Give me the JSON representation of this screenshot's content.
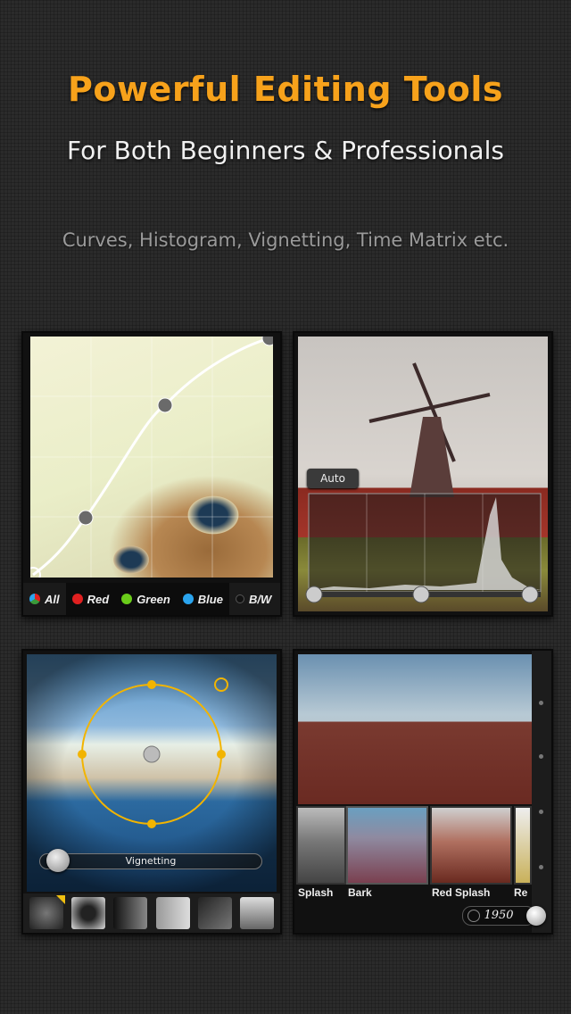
{
  "header": {
    "title": "Powerful Editing Tools",
    "subtitle": "For Both Beginners & Professionals",
    "caption": "Curves, Histogram, Vignetting, Time Matrix etc."
  },
  "curves": {
    "channels": [
      {
        "label": "All",
        "color": "#3a9a3a",
        "active": false
      },
      {
        "label": "Red",
        "color": "#e02020",
        "active": true
      },
      {
        "label": "Green",
        "color": "#6acc1a",
        "active": false
      },
      {
        "label": "Blue",
        "color": "#2aa4ee",
        "active": false
      },
      {
        "label": "B/W",
        "color": "#111111",
        "active": false
      }
    ]
  },
  "histogram": {
    "auto_label": "Auto"
  },
  "vignetting": {
    "slider_label": "Vignetting",
    "accent": "#f2b400",
    "presets": [
      "preset-1",
      "preset-2",
      "preset-3",
      "preset-4",
      "preset-5",
      "preset-6"
    ]
  },
  "time_matrix": {
    "filters": [
      "Splash",
      "Bark",
      "Red Splash",
      "Re"
    ],
    "year": "1950"
  }
}
